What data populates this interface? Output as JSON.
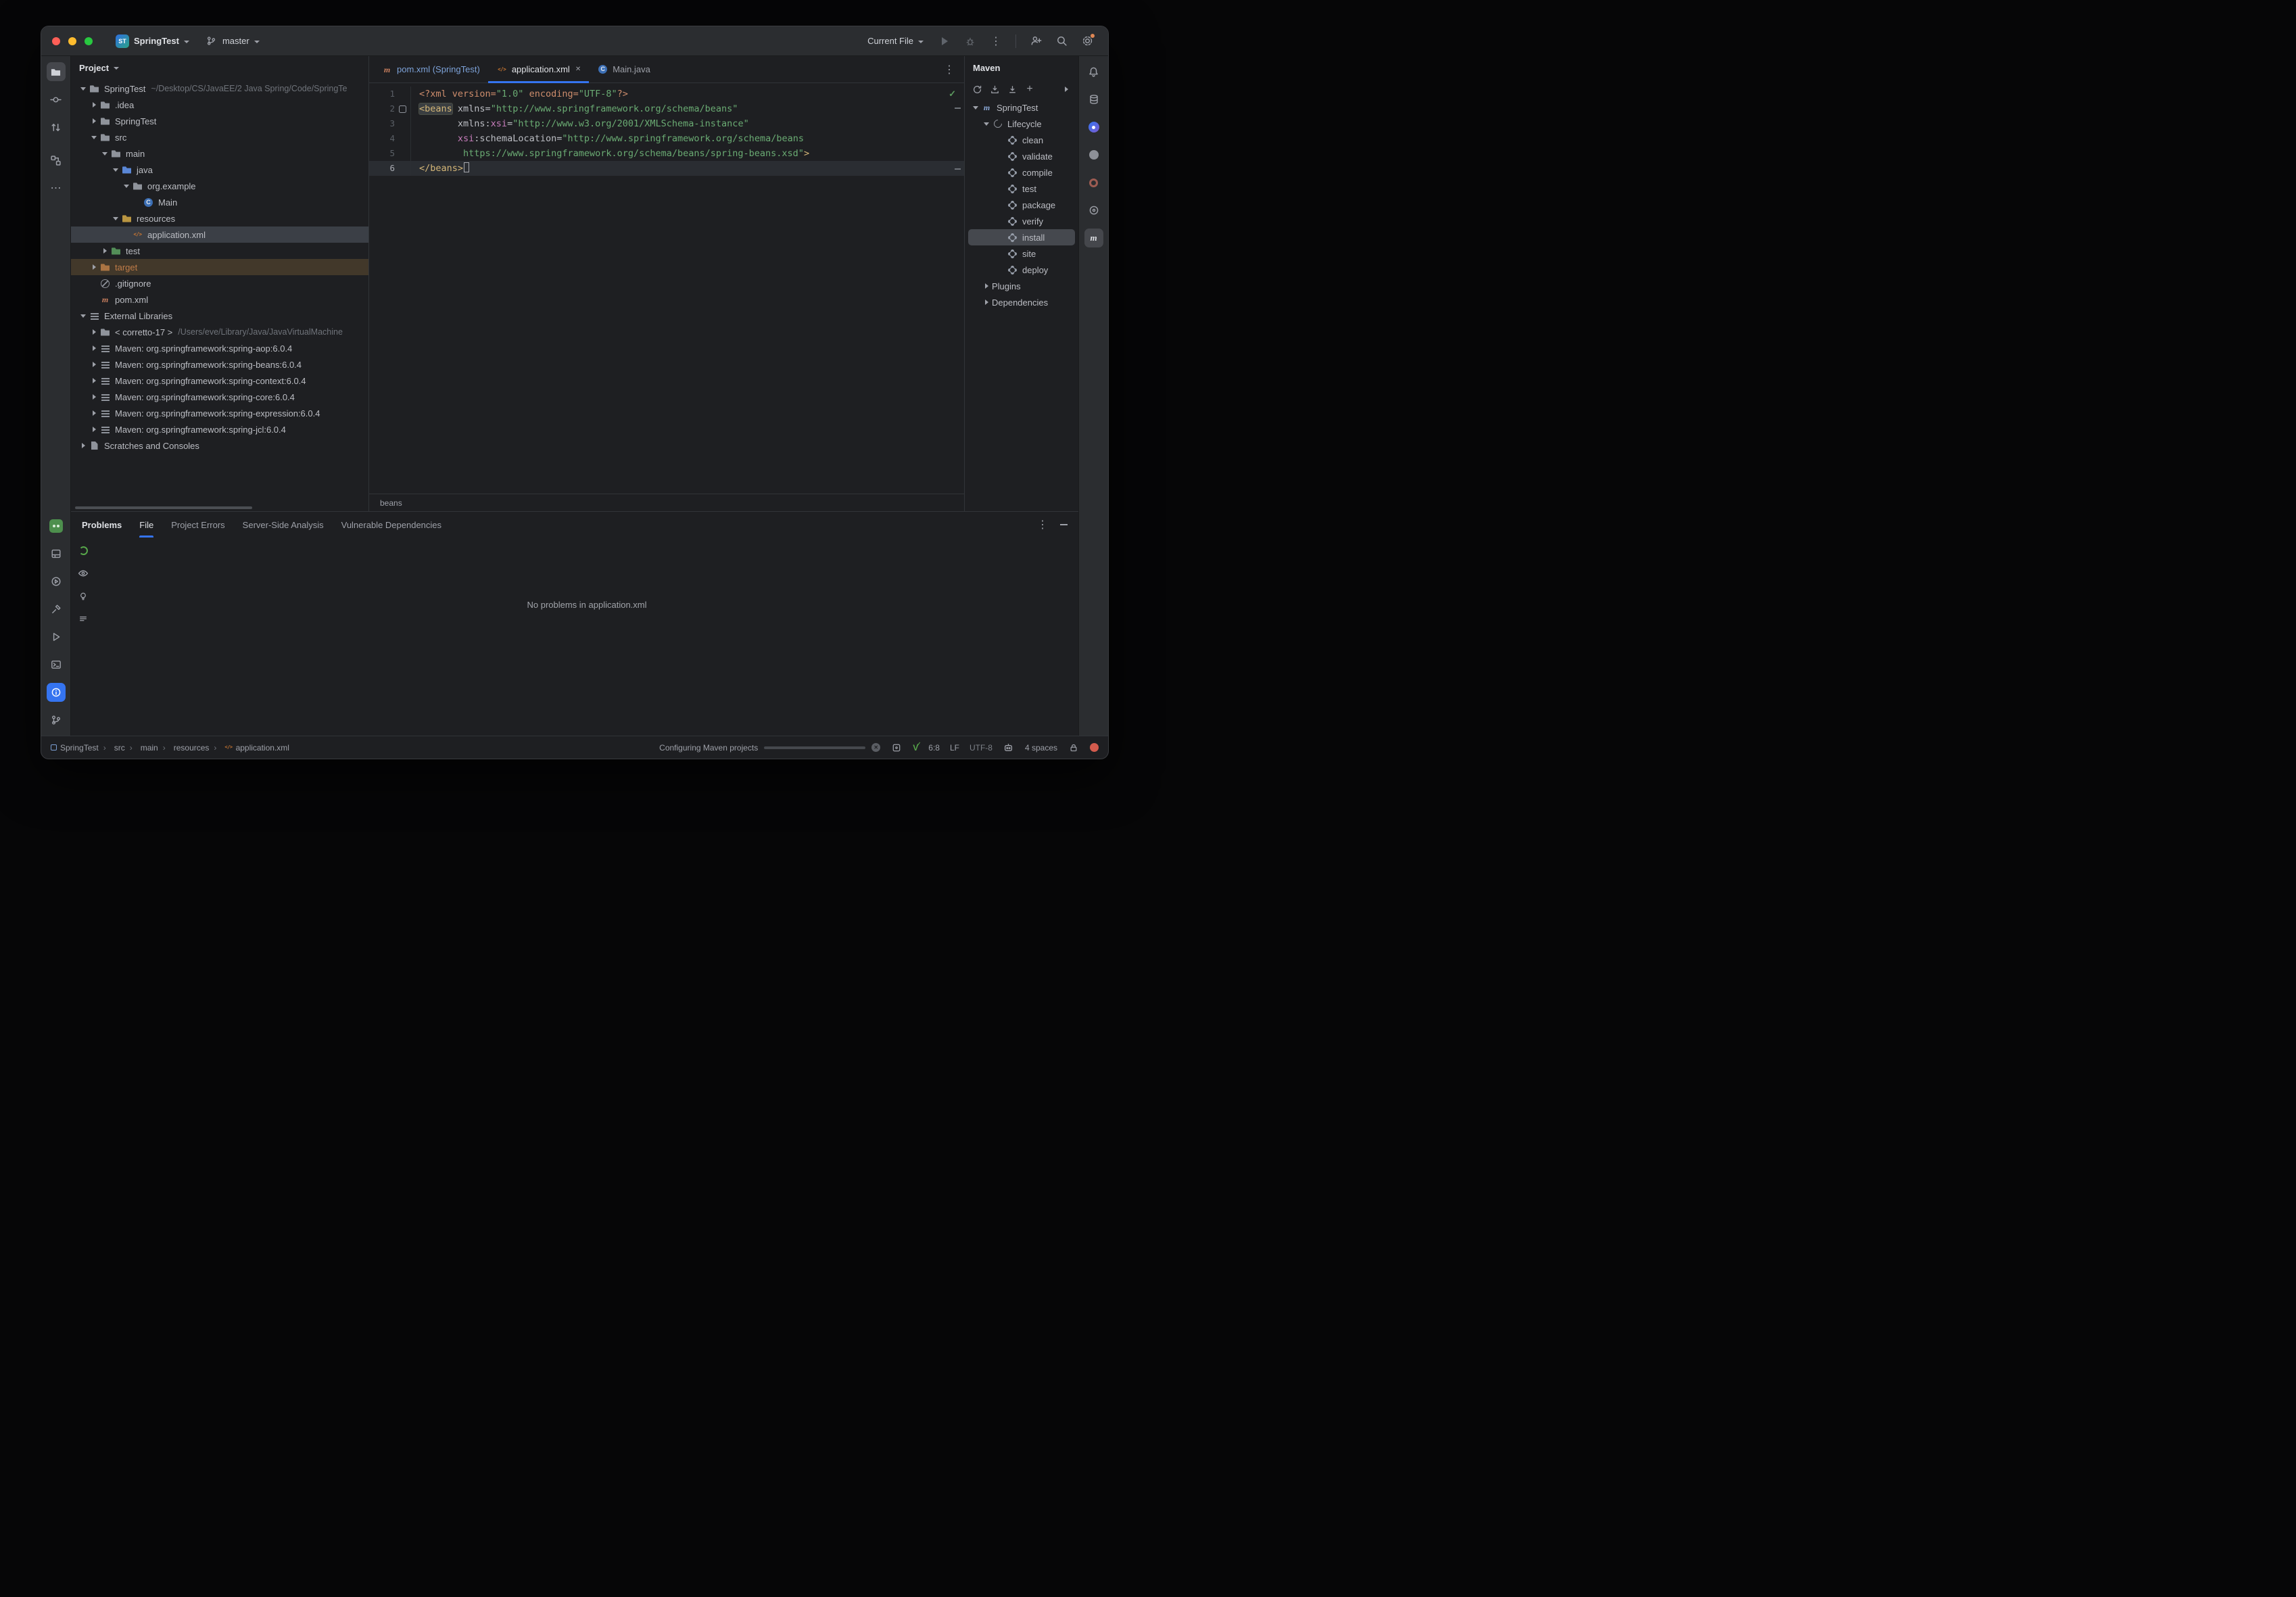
{
  "titlebar": {
    "project_badge": "ST",
    "project_name": "SpringTest",
    "branch": "master",
    "run_config": "Current File"
  },
  "project": {
    "header": "Project",
    "tree": [
      {
        "ind": "i0",
        "chev": "down",
        "icon": "ico-folder",
        "label": "SpringTest",
        "extra": "~/Desktop/CS/JavaEE/2 Java Spring/Code/SpringTe"
      },
      {
        "ind": "i1",
        "chev": "right",
        "icon": "ico-folder",
        "label": ".idea"
      },
      {
        "ind": "i1",
        "chev": "right",
        "icon": "ico-folder",
        "label": "SpringTest"
      },
      {
        "ind": "i1",
        "chev": "down",
        "icon": "ico-folder",
        "label": "src"
      },
      {
        "ind": "i2",
        "chev": "down",
        "icon": "ico-folder",
        "label": "main"
      },
      {
        "ind": "i3",
        "chev": "down",
        "icon": "ico-folder c-src",
        "label": "java"
      },
      {
        "ind": "i4",
        "chev": "down",
        "icon": "ico-folder",
        "label": "org.example"
      },
      {
        "ind": "i5",
        "chev": "none",
        "icon": "ico-class",
        "label": "Main"
      },
      {
        "ind": "i3",
        "chev": "down",
        "icon": "ico-folder c-res",
        "label": "resources"
      },
      {
        "ind": "i4",
        "chev": "none",
        "icon": "ico-xml",
        "label": "application.xml",
        "row": "sel"
      },
      {
        "ind": "i2",
        "chev": "right",
        "icon": "ico-folder c-test",
        "label": "test"
      },
      {
        "ind": "i1",
        "chev": "right",
        "icon": "ico-folder c-exc",
        "label": "target",
        "row": "exc",
        "cls": "t-orange"
      },
      {
        "ind": "i1",
        "chev": "none",
        "icon": "ico-ignored",
        "label": ".gitignore"
      },
      {
        "ind": "i1",
        "chev": "none",
        "icon": "ico-maven",
        "label": "pom.xml"
      },
      {
        "ind": "i0",
        "chev": "down",
        "icon": "ico-lib",
        "label": "External Libraries"
      },
      {
        "ind": "i1",
        "chev": "right",
        "icon": "ico-jdk",
        "label": "< corretto-17 >",
        "extra": "/Users/eve/Library/Java/JavaVirtualMachine"
      },
      {
        "ind": "i1",
        "chev": "right",
        "icon": "ico-lib2",
        "label": "Maven: org.springframework:spring-aop:6.0.4"
      },
      {
        "ind": "i1",
        "chev": "right",
        "icon": "ico-lib2",
        "label": "Maven: org.springframework:spring-beans:6.0.4"
      },
      {
        "ind": "i1",
        "chev": "right",
        "icon": "ico-lib2",
        "label": "Maven: org.springframework:spring-context:6.0.4"
      },
      {
        "ind": "i1",
        "chev": "right",
        "icon": "ico-lib2",
        "label": "Maven: org.springframework:spring-core:6.0.4"
      },
      {
        "ind": "i1",
        "chev": "right",
        "icon": "ico-lib2",
        "label": "Maven: org.springframework:spring-expression:6.0.4"
      },
      {
        "ind": "i1",
        "chev": "right",
        "icon": "ico-lib2",
        "label": "Maven: org.springframework:spring-jcl:6.0.4"
      },
      {
        "ind": "i0",
        "chev": "right",
        "icon": "ico-scratch",
        "label": "Scratches and Consoles"
      }
    ]
  },
  "tabs": [
    {
      "icon": "ico-maven",
      "label": "pom.xml (SpringTest)",
      "cls": "t-blue"
    },
    {
      "icon": "ico-xml",
      "label": "application.xml",
      "active": "on",
      "close": "show"
    },
    {
      "icon": "ico-class",
      "label": "Main.java"
    }
  ],
  "editor": {
    "breadcrumb": "beans",
    "lines": [
      {
        "n": 1,
        "t": [
          [
            "<?xml version=",
            "pro"
          ],
          [
            "\"1.0\"",
            "st"
          ],
          [
            " encoding=",
            "pro"
          ],
          [
            "\"UTF-8\"",
            "st"
          ],
          [
            "?>",
            "pro"
          ]
        ]
      },
      {
        "n": 2,
        "g": true,
        "t": [
          [
            "<beans",
            "tg hl"
          ],
          [
            " xmlns=",
            "at"
          ],
          [
            "\"http://www.springframework.org/schema/beans\"",
            "st"
          ]
        ]
      },
      {
        "n": 3,
        "t": [
          [
            "       xmlns:",
            "at"
          ],
          [
            "xsi",
            "ns"
          ],
          [
            "=",
            "at"
          ],
          [
            "\"http://www.w3.org/2001/XMLSchema-instance\"",
            "st"
          ]
        ]
      },
      {
        "n": 4,
        "t": [
          [
            "       ",
            "at"
          ],
          [
            "xsi",
            "ns"
          ],
          [
            ":schemaLocation=",
            "at"
          ],
          [
            "\"http://www.springframework.org/schema/beans",
            "st"
          ]
        ]
      },
      {
        "n": 5,
        "t": [
          [
            "        https://www.springframework.org/schema/beans/spring-beans.xsd\"",
            "st"
          ],
          [
            ">",
            "tg"
          ]
        ]
      },
      {
        "n": 6,
        "cur": true,
        "caret": true,
        "t": [
          [
            "</beans>",
            "tg"
          ]
        ]
      }
    ]
  },
  "maven": {
    "title": "Maven",
    "tree": [
      {
        "ind": "i0",
        "chev": "down",
        "icon": "ico-m",
        "label": "SpringTest"
      },
      {
        "ind": "i1",
        "chev": "down",
        "icon": "ico-lc",
        "label": "Lifecycle"
      },
      {
        "ind": "i2",
        "chev": "none",
        "icon": "ico-gear",
        "label": "clean"
      },
      {
        "ind": "i2",
        "chev": "none",
        "icon": "ico-gear",
        "label": "validate"
      },
      {
        "ind": "i2",
        "chev": "none",
        "icon": "ico-gear",
        "label": "compile"
      },
      {
        "ind": "i2",
        "chev": "none",
        "icon": "ico-gear",
        "label": "test"
      },
      {
        "ind": "i2",
        "chev": "none",
        "icon": "ico-gear",
        "label": "package"
      },
      {
        "ind": "i2",
        "chev": "none",
        "icon": "ico-gear",
        "label": "verify"
      },
      {
        "ind": "i2",
        "chev": "none",
        "icon": "ico-gear",
        "label": "install",
        "row": "msel"
      },
      {
        "ind": "i2",
        "chev": "none",
        "icon": "ico-gear",
        "label": "site"
      },
      {
        "ind": "i2",
        "chev": "none",
        "icon": "ico-gear",
        "label": "deploy"
      },
      {
        "ind": "i1",
        "chev": "right",
        "icon": "ico-none",
        "label": "Plugins"
      },
      {
        "ind": "i1",
        "chev": "right",
        "icon": "ico-none",
        "label": "Dependencies"
      }
    ]
  },
  "problems": {
    "title": "Problems",
    "tabs": [
      {
        "label": "File",
        "active": "on"
      },
      {
        "label": "Project Errors"
      },
      {
        "label": "Server-Side Analysis"
      },
      {
        "label": "Vulnerable Dependencies"
      }
    ],
    "empty_message": "No problems in application.xml"
  },
  "statusbar": {
    "crumbs": [
      {
        "icon": "sq",
        "label": "SpringTest"
      },
      {
        "label": "src"
      },
      {
        "label": "main"
      },
      {
        "label": "resources"
      },
      {
        "icon": "xml",
        "label": "application.xml"
      }
    ],
    "progress_label": "Configuring Maven projects",
    "progress_pct": 92,
    "caret": "6:8",
    "line_sep": "LF",
    "encoding": "UTF-8",
    "indent": "4 spaces"
  },
  "icons": {
    "accent_color": "#3574f0",
    "st-badge": "teal-blue rounded square with ST",
    "branch-icon": "git branch glyph",
    "chevron-down-icon": "small down triangle",
    "run-play-icon": "gray disabled play triangle",
    "debug-bug-icon": "bug outline",
    "kebab-icon": "vertical ellipsis",
    "add-user-icon": "person with plus",
    "search-icon": "magnifier",
    "settings-gear-icon": "gear with orange update dot",
    "project-tool-icon": "folder (active)",
    "commit-tool-icon": "circle with side lines",
    "pull-requests-tool-icon": "up/down arrows",
    "structure-tool-icon": "linked squares",
    "plugin-icon": "green rounded square",
    "layout-tool-icon": "window layout rect",
    "services-tool-icon": "play in circle",
    "build-tool-icon": "hammer",
    "run-tool-icon": "play triangle outline",
    "terminal-tool-icon": "terminal box",
    "problems-tool-icon": "info circle on blue (active)",
    "version-control-tool-icon": "git branch",
    "notifications-bell-icon": "bell",
    "database-icon": "db cylinder",
    "ai-assistant-icon": "blue filled circle",
    "gradle-icon": "gray filled circle",
    "coverage-donut-icon": "maroon ring",
    "dependencies-icon": "outlined circle with dot",
    "maven-tool-icon": "italic m (active)",
    "reload-maven-icon": "circular arrow",
    "download-sources-icon": "arrow into tray",
    "execute-goal-icon": "arrow down with bar",
    "add-icon": "plus",
    "expand-icon": "right chevron",
    "rescan-icon": "green spinner ring",
    "eye-icon": "eye outline",
    "lightbulb-icon": "bulb outline",
    "log-list-icon": "three lines",
    "cancel-progress-icon": "gray circle with x",
    "status-plugin-icon": "small grid square",
    "v-check-icon": "green V with check",
    "robot-icon": "robot head",
    "lock-icon": "padlock",
    "error-badge": "red filled circle"
  }
}
